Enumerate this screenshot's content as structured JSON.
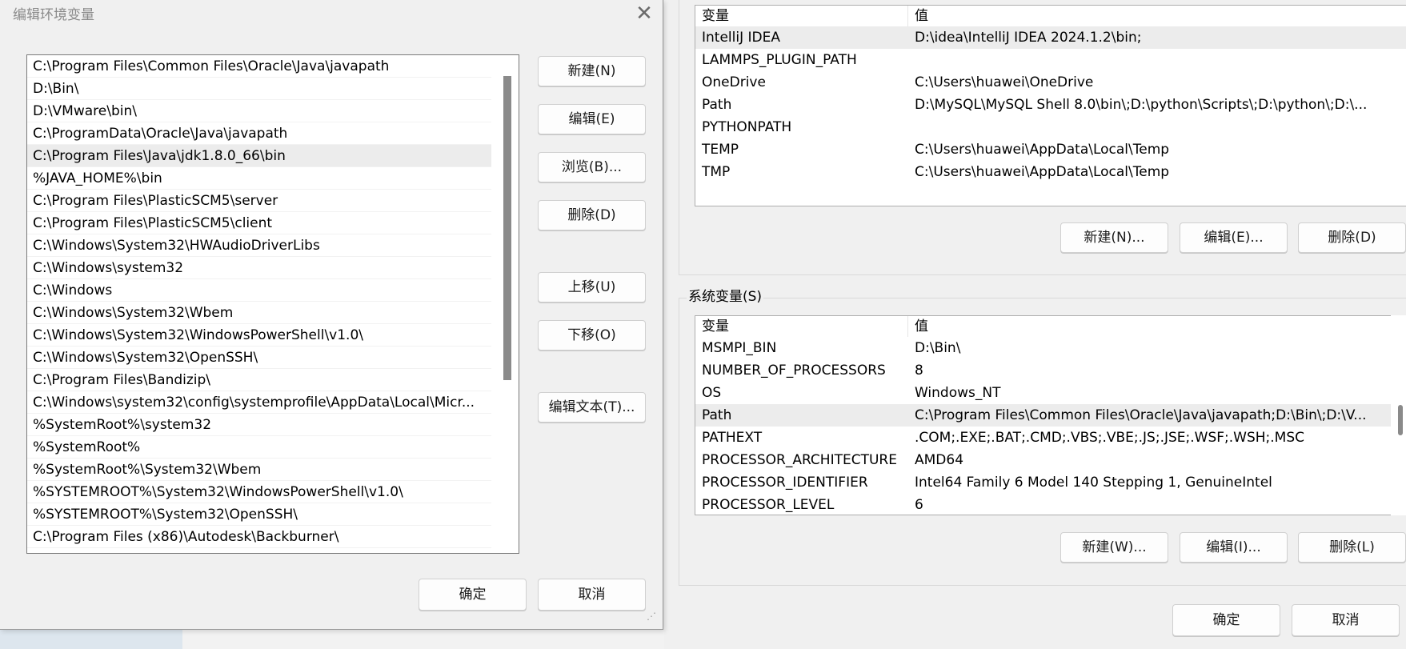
{
  "dialog": {
    "title": "编辑环境变量",
    "close_label": "✕",
    "paths": [
      "C:\\Program Files\\Common Files\\Oracle\\Java\\javapath",
      "D:\\Bin\\",
      "D:\\VMware\\bin\\",
      "C:\\ProgramData\\Oracle\\Java\\javapath",
      "C:\\Program Files\\Java\\jdk1.8.0_66\\bin",
      "%JAVA_HOME%\\bin",
      "C:\\Program Files\\PlasticSCM5\\server",
      "C:\\Program Files\\PlasticSCM5\\client",
      "C:\\Windows\\System32\\HWAudioDriverLibs",
      "C:\\Windows\\system32",
      "C:\\Windows",
      "C:\\Windows\\System32\\Wbem",
      "C:\\Windows\\System32\\WindowsPowerShell\\v1.0\\",
      "C:\\Windows\\System32\\OpenSSH\\",
      "C:\\Program Files\\Bandizip\\",
      "C:\\Windows\\system32\\config\\systemprofile\\AppData\\Local\\Micr...",
      "%SystemRoot%\\system32",
      "%SystemRoot%",
      "%SystemRoot%\\System32\\Wbem",
      "%SYSTEMROOT%\\System32\\WindowsPowerShell\\v1.0\\",
      "%SYSTEMROOT%\\System32\\OpenSSH\\",
      "C:\\Program Files (x86)\\Autodesk\\Backburner\\"
    ],
    "buttons": {
      "new": "新建(N)",
      "edit": "编辑(E)",
      "browse": "浏览(B)...",
      "delete": "删除(D)",
      "move_up": "上移(U)",
      "move_down": "下移(O)",
      "edit_text": "编辑文本(T)...",
      "ok": "确定",
      "cancel": "取消"
    }
  },
  "env_window": {
    "user_vars": {
      "col_var": "变量",
      "col_val": "值",
      "rows": [
        {
          "name": "IntelliJ IDEA",
          "value": "D:\\idea\\IntelliJ IDEA 2024.1.2\\bin;"
        },
        {
          "name": "LAMMPS_PLUGIN_PATH",
          "value": ""
        },
        {
          "name": "OneDrive",
          "value": "C:\\Users\\huawei\\OneDrive"
        },
        {
          "name": "Path",
          "value": "D:\\MySQL\\MySQL Shell 8.0\\bin\\;D:\\python\\Scripts\\;D:\\python\\;D:\\..."
        },
        {
          "name": "PYTHONPATH",
          "value": ""
        },
        {
          "name": "TEMP",
          "value": "C:\\Users\\huawei\\AppData\\Local\\Temp"
        },
        {
          "name": "TMP",
          "value": "C:\\Users\\huawei\\AppData\\Local\\Temp"
        }
      ],
      "buttons": {
        "new": "新建(N)...",
        "edit": "编辑(E)...",
        "delete": "删除(D)"
      }
    },
    "sys_vars": {
      "group_title": "系统变量(S)",
      "col_var": "变量",
      "col_val": "值",
      "rows": [
        {
          "name": "MSMPI_BIN",
          "value": "D:\\Bin\\"
        },
        {
          "name": "NUMBER_OF_PROCESSORS",
          "value": "8"
        },
        {
          "name": "OS",
          "value": "Windows_NT"
        },
        {
          "name": "Path",
          "value": "C:\\Program Files\\Common Files\\Oracle\\Java\\javapath;D:\\Bin\\;D:\\V..."
        },
        {
          "name": "PATHEXT",
          "value": ".COM;.EXE;.BAT;.CMD;.VBS;.VBE;.JS;.JSE;.WSF;.WSH;.MSC"
        },
        {
          "name": "PROCESSOR_ARCHITECTURE",
          "value": "AMD64"
        },
        {
          "name": "PROCESSOR_IDENTIFIER",
          "value": "Intel64 Family 6 Model 140 Stepping 1, GenuineIntel"
        },
        {
          "name": "PROCESSOR_LEVEL",
          "value": "6"
        }
      ],
      "buttons": {
        "new": "新建(W)...",
        "edit": "编辑(I)...",
        "delete": "删除(L)"
      }
    },
    "footer": {
      "ok": "确定",
      "cancel": "取消"
    }
  }
}
